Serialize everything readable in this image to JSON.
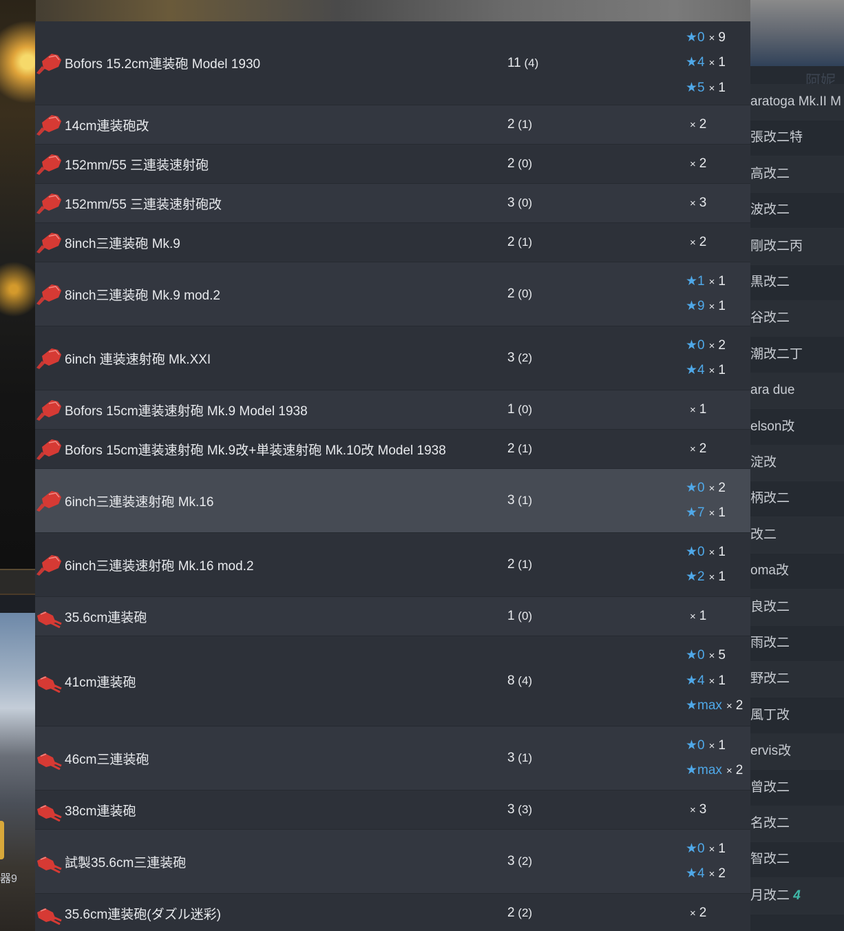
{
  "list": {
    "rows": [
      {
        "name": "Bofors 15.2cm連装砲 Model 1930",
        "total": "11",
        "fitted": "(4)",
        "icon": "medium-gun-icon",
        "height": 121,
        "style": "",
        "levels": [
          {
            "star": "★0",
            "count": "9"
          },
          {
            "star": "★4",
            "count": "1"
          },
          {
            "star": "★5",
            "count": "1"
          }
        ]
      },
      {
        "name": "14cm連装砲改",
        "total": "2",
        "fitted": "(1)",
        "icon": "medium-gun-icon",
        "height": 56,
        "style": "alt",
        "levels": [
          {
            "star": "",
            "count": "2"
          }
        ]
      },
      {
        "name": "152mm/55 三連装速射砲",
        "total": "2",
        "fitted": "(0)",
        "icon": "medium-gun-icon",
        "height": 56,
        "style": "",
        "levels": [
          {
            "star": "",
            "count": "2"
          }
        ]
      },
      {
        "name": "152mm/55 三連装速射砲改",
        "total": "3",
        "fitted": "(0)",
        "icon": "medium-gun-icon",
        "height": 56,
        "style": "alt",
        "levels": [
          {
            "star": "",
            "count": "3"
          }
        ]
      },
      {
        "name": "8inch三連装砲 Mk.9",
        "total": "2",
        "fitted": "(1)",
        "icon": "medium-gun-icon",
        "height": 56,
        "style": "",
        "levels": [
          {
            "star": "",
            "count": "2"
          }
        ]
      },
      {
        "name": "8inch三連装砲 Mk.9 mod.2",
        "total": "2",
        "fitted": "(0)",
        "icon": "medium-gun-icon",
        "height": 92,
        "style": "alt",
        "levels": [
          {
            "star": "★1",
            "count": "1"
          },
          {
            "star": "★9",
            "count": "1"
          }
        ]
      },
      {
        "name": "6inch 連装速射砲 Mk.XXI",
        "total": "3",
        "fitted": "(2)",
        "icon": "medium-gun-icon",
        "height": 92,
        "style": "",
        "levels": [
          {
            "star": "★0",
            "count": "2"
          },
          {
            "star": "★4",
            "count": "1"
          }
        ]
      },
      {
        "name": "Bofors 15cm連装速射砲 Mk.9 Model 1938",
        "total": "1",
        "fitted": "(0)",
        "icon": "medium-gun-icon",
        "height": 56,
        "style": "alt",
        "levels": [
          {
            "star": "",
            "count": "1"
          }
        ]
      },
      {
        "name": "Bofors 15cm連装速射砲 Mk.9改+単装速射砲 Mk.10改 Model 1938",
        "total": "2",
        "fitted": "(1)",
        "icon": "medium-gun-icon",
        "height": 56,
        "style": "",
        "levels": [
          {
            "star": "",
            "count": "2"
          }
        ]
      },
      {
        "name": "6inch三連装速射砲 Mk.16",
        "total": "3",
        "fitted": "(1)",
        "icon": "medium-gun-icon",
        "height": 92,
        "style": "hl",
        "levels": [
          {
            "star": "★0",
            "count": "2"
          },
          {
            "star": "★7",
            "count": "1"
          }
        ]
      },
      {
        "name": "6inch三連装速射砲 Mk.16 mod.2",
        "total": "2",
        "fitted": "(1)",
        "icon": "medium-gun-icon",
        "height": 92,
        "style": "",
        "levels": [
          {
            "star": "★0",
            "count": "1"
          },
          {
            "star": "★2",
            "count": "1"
          }
        ]
      },
      {
        "name": "35.6cm連装砲",
        "total": "1",
        "fitted": "(0)",
        "icon": "large-gun-icon",
        "height": 56,
        "style": "alt",
        "levels": [
          {
            "star": "",
            "count": "1"
          }
        ]
      },
      {
        "name": "41cm連装砲",
        "total": "8",
        "fitted": "(4)",
        "icon": "large-gun-icon",
        "height": 130,
        "style": "",
        "levels": [
          {
            "star": "★0",
            "count": "5"
          },
          {
            "star": "★4",
            "count": "1"
          },
          {
            "star": "★max",
            "count": "2"
          }
        ]
      },
      {
        "name": "46cm三連装砲",
        "total": "3",
        "fitted": "(1)",
        "icon": "large-gun-icon",
        "height": 92,
        "style": "alt",
        "levels": [
          {
            "star": "★0",
            "count": "1"
          },
          {
            "star": "★max",
            "count": "2"
          }
        ]
      },
      {
        "name": "38cm連装砲",
        "total": "3",
        "fitted": "(3)",
        "icon": "large-gun-icon",
        "height": 56,
        "style": "",
        "levels": [
          {
            "star": "",
            "count": "3"
          }
        ]
      },
      {
        "name": "試製35.6cm三連装砲",
        "total": "3",
        "fitted": "(2)",
        "icon": "large-gun-icon",
        "height": 92,
        "style": "alt",
        "levels": [
          {
            "star": "★0",
            "count": "1"
          },
          {
            "star": "★4",
            "count": "2"
          }
        ]
      },
      {
        "name": "35.6cm連装砲(ダズル迷彩)",
        "total": "2",
        "fitted": "(2)",
        "icon": "large-gun-icon",
        "height": 56,
        "style": "",
        "levels": [
          {
            "star": "",
            "count": "2"
          }
        ]
      },
      {
        "name": "",
        "total": "",
        "fitted": "",
        "icon": "",
        "height": 40,
        "style": "alt",
        "levels": []
      }
    ],
    "multiply_sign": "×"
  },
  "sidebar": {
    "header": "阿妮",
    "items": [
      "aratoga Mk.II M",
      "張改二特",
      "高改二",
      "波改二",
      "剛改二丙",
      "黒改二",
      "谷改二",
      "潮改二丁",
      "ara due",
      "elson改",
      "淀改",
      "柄改二",
      "改二",
      "oma改",
      "良改二",
      "雨改二",
      "野改二",
      "風丁改",
      "ervis改",
      "曾改二",
      "名改二",
      "智改二",
      "月改二"
    ],
    "last_tag": "4"
  },
  "background": {
    "left_text": "器9"
  },
  "colors": {
    "panel": "#2d3139",
    "row_alt": "#333740",
    "row_highlight": "#464b54",
    "star": "#4fa8e8",
    "gun_icon": "#d63a34",
    "text": "#e8eaed"
  }
}
